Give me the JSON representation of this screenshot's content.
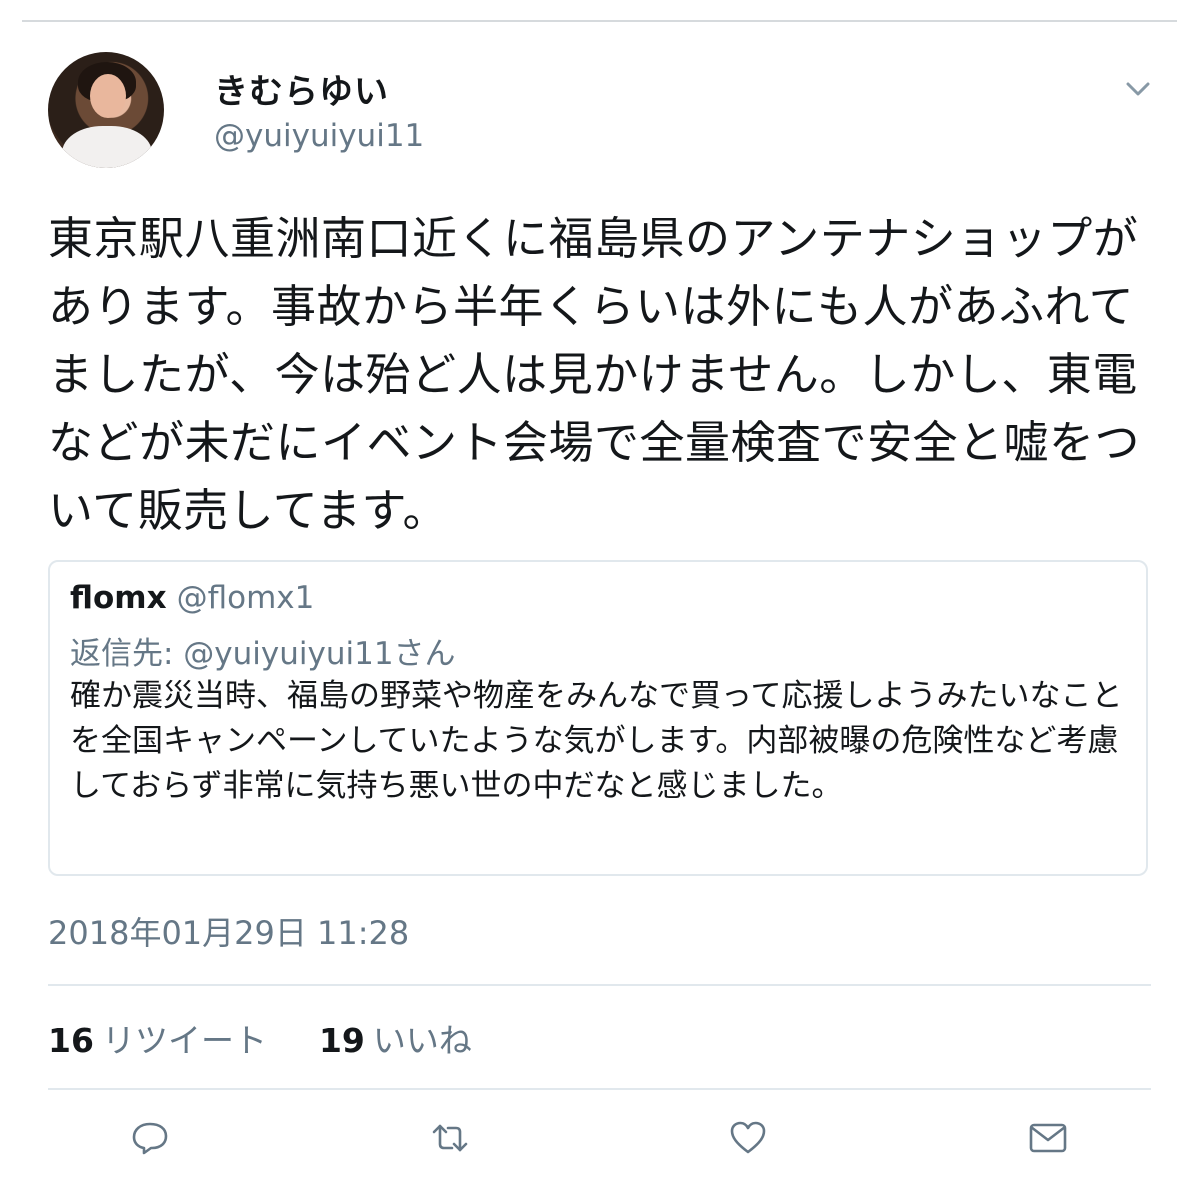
{
  "author": {
    "name": "きむらゆい",
    "handle": "@yuiyuiyui11"
  },
  "tweet_text": "東京駅八重洲南口近くに福島県のアンテナショップがあります。事故から半年くらいは外にも人があふれてましたが、今は殆ど人は見かけません。しかし、東電などが未だにイベント会場で全量検査で安全と嘘をついて販売してます。",
  "quoted": {
    "name": "flomx",
    "handle": "@flomx1",
    "reply_to": "返信先: @yuiyuiyui11さん",
    "text": "確か震災当時、福島の野菜や物産をみんなで買って応援しようみたいなことを全国キャンペーンしていたような気がします。内部被曝の危険性など考慮しておらず非常に気持ち悪い世の中だなと感じました。"
  },
  "timestamp": "2018年01月29日 11:28",
  "stats": {
    "retweets_count": "16",
    "retweets_label": "リツイート",
    "likes_count": "19",
    "likes_label": "いいね"
  },
  "icons": [
    "chevron-down-icon",
    "reply-icon",
    "retweet-icon",
    "like-icon",
    "message-icon"
  ],
  "colors": {
    "text": "#14171a",
    "secondary": "#657786",
    "border": "#e1e8ed"
  }
}
